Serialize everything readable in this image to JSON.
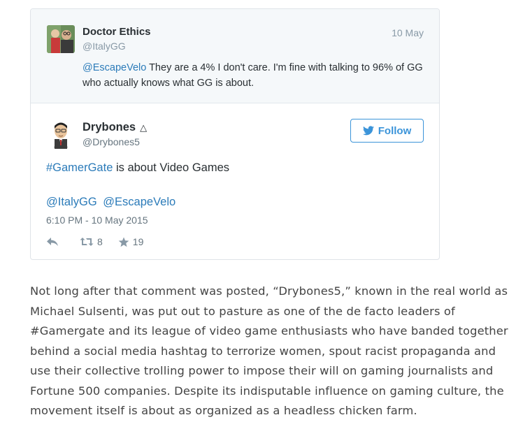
{
  "parent_tweet": {
    "name": "Doctor Ethics",
    "handle": "@ItalyGG",
    "date": "10 May",
    "mention": "@EscapeVelo",
    "text": " They are a 4% I don't care. I'm fine with talking to 96% of GG who actually knows what GG is about."
  },
  "main_tweet": {
    "name": "Drybones",
    "name_suffix": "△",
    "handle": "@Drybones5",
    "follow_label": "Follow",
    "hashtag": "#GamerGate",
    "text": " is about Video Games",
    "mentions": [
      "@ItalyGG",
      "@EscapeVelo"
    ],
    "timestamp": "6:10 PM - 10 May 2015",
    "retweets": "8",
    "favorites": "19"
  },
  "colors": {
    "link": "#2b7bb9",
    "follow": "#3b94d9"
  },
  "article": {
    "paragraph": "Not long after that comment was posted, “Drybones5,” known in the real world as Michael Sulsenti, was put out to pasture as one of the de facto leaders of #Gamergate and its league of video game enthusiasts who have banded together behind a social media hashtag to terrorize women, spout racist propaganda and use their collective trolling power to impose their will on gaming journalists and Fortune 500 companies. Despite its indisputable influence on gaming culture, the movement itself is about as organized as a headless chicken farm."
  }
}
